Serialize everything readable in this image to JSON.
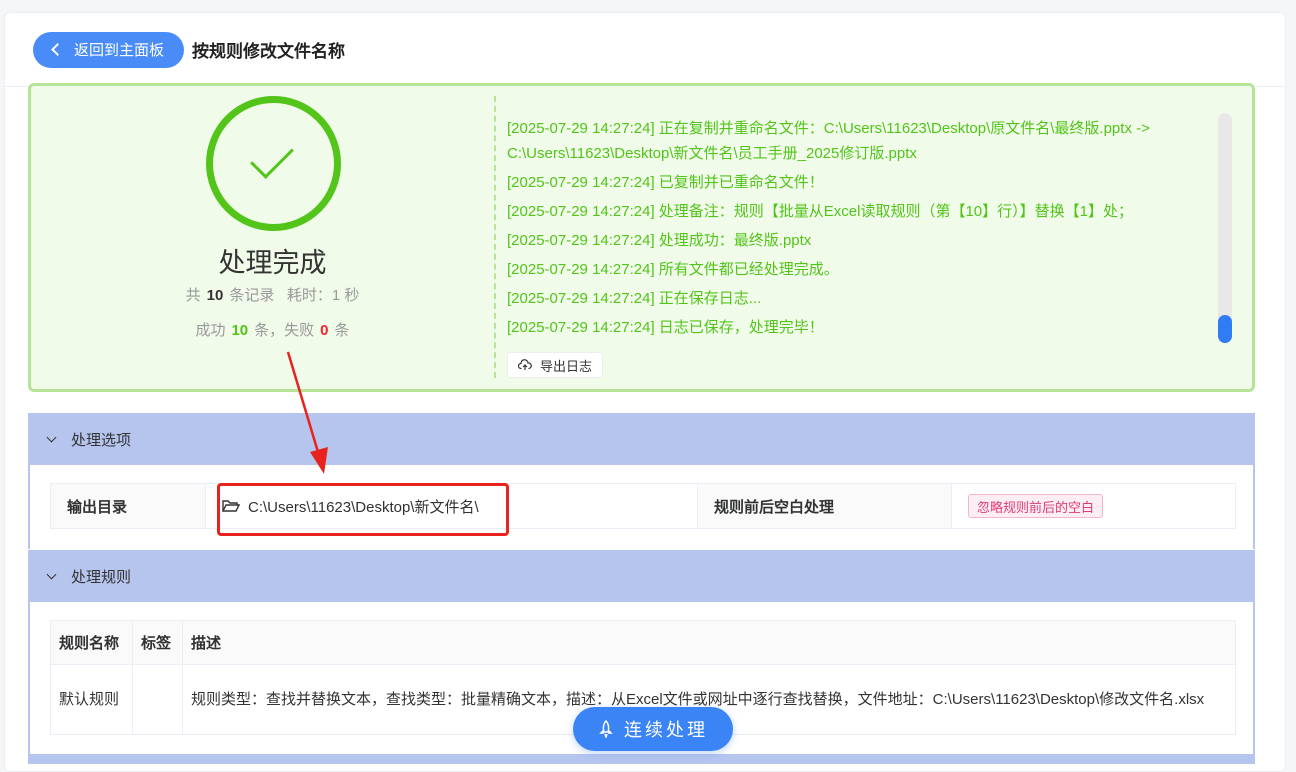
{
  "header": {
    "back_label": "返回到主面板",
    "title": "按规则修改文件名称"
  },
  "result": {
    "title": "处理完成",
    "total_prefix": "共",
    "total_count": "10",
    "total_suffix": "条记录",
    "time_label": "耗时：1 秒",
    "success_prefix": "成功",
    "success_count": "10",
    "success_suffix": "条，失败",
    "fail_count": "0",
    "fail_suffix": "条",
    "log_lines": [
      "[2025-07-29 14:27:24] 正在复制并重命名文件：C:\\Users\\11623\\Desktop\\原文件名\\最终版.pptx -> C:\\Users\\11623\\Desktop\\新文件名\\员工手册_2025修订版.pptx",
      "[2025-07-29 14:27:24] 已复制并已重命名文件！",
      "[2025-07-29 14:27:24] 处理备注：规则【批量从Excel读取规则（第【10】行）】替换【1】处；",
      "[2025-07-29 14:27:24] 处理成功：最终版.pptx",
      "[2025-07-29 14:27:24] 所有文件都已经处理完成。",
      "[2025-07-29 14:27:24] 正在保存日志...",
      "[2025-07-29 14:27:24] 日志已保存，处理完毕！"
    ],
    "export_label": "导出日志"
  },
  "options": {
    "section_title": "处理选项",
    "output_dir_label": "输出目录",
    "output_dir_value": "C:\\Users\\11623\\Desktop\\新文件名\\",
    "whitespace_label": "规则前后空白处理",
    "whitespace_value": "忽略规则前后的空白"
  },
  "rules": {
    "section_title": "处理规则",
    "columns": [
      "规则名称",
      "标签",
      "描述"
    ],
    "rows": [
      {
        "name": "默认规则",
        "tag": "",
        "desc": "规则类型：查找并替换文本，查找类型：批量精确文本，描述：从Excel文件或网址中逐行查找替换，文件地址：C:\\Users\\11623\\Desktop\\修改文件名.xlsx"
      }
    ]
  },
  "float_button": "连续处理",
  "colors": {
    "primary": "#3b84f5",
    "success": "#52c41a",
    "danger": "#f5222d",
    "annotation": "#e8231f"
  }
}
